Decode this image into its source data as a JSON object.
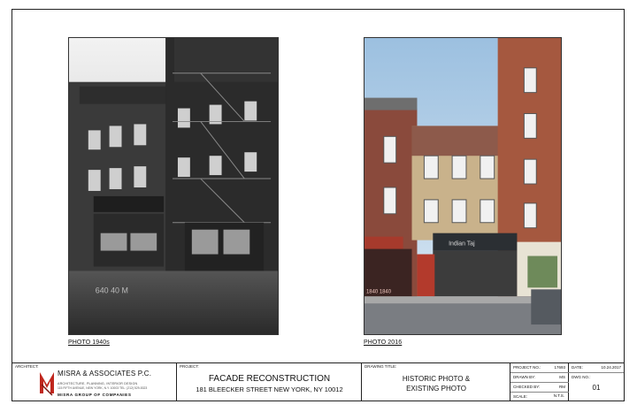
{
  "photos": {
    "left_caption": "PHOTO 1940s",
    "right_caption": "PHOTO 2016",
    "left_storefront_sign": "640 40 M",
    "right_storefront_sign": "Indian Taj",
    "right_door_numbers": "1840 1840"
  },
  "title_block": {
    "architect_label": "ARCHITECT:",
    "firm_name": "MISRA & ASSOCIATES P.C.",
    "firm_tagline": "ARCHITECTURE, PLANNING, INTERIOR DESIGN",
    "firm_address": "115 FIFTH AVENUE, NEW YORK, N.Y. 10003 TEL: (212) 529-5323",
    "firm_group": "MISRA GROUP OF COMPANIES",
    "project_label": "PROJECT:",
    "project_title": "FACADE RECONSTRUCTION",
    "project_address": "181 BLEECKER STREET NEW YORK, NY 10012",
    "drawing_label": "DRAWING TITLE:",
    "drawing_title_1": "HISTORIC PHOTO &",
    "drawing_title_2": "EXISTING PHOTO",
    "project_no_label": "PROJECT NO.:",
    "project_no": "17693",
    "drawn_by_label": "DRAWN BY:",
    "drawn_by": "MS",
    "checked_by_label": "CHECKED BY:",
    "checked_by": "RM",
    "scale_label": "SCALE:",
    "scale": "N.T.S.",
    "date_label": "DATE:",
    "date": "10.24.2017",
    "dwg_no_label": "DWG NO.:",
    "dwg_no": "01"
  }
}
